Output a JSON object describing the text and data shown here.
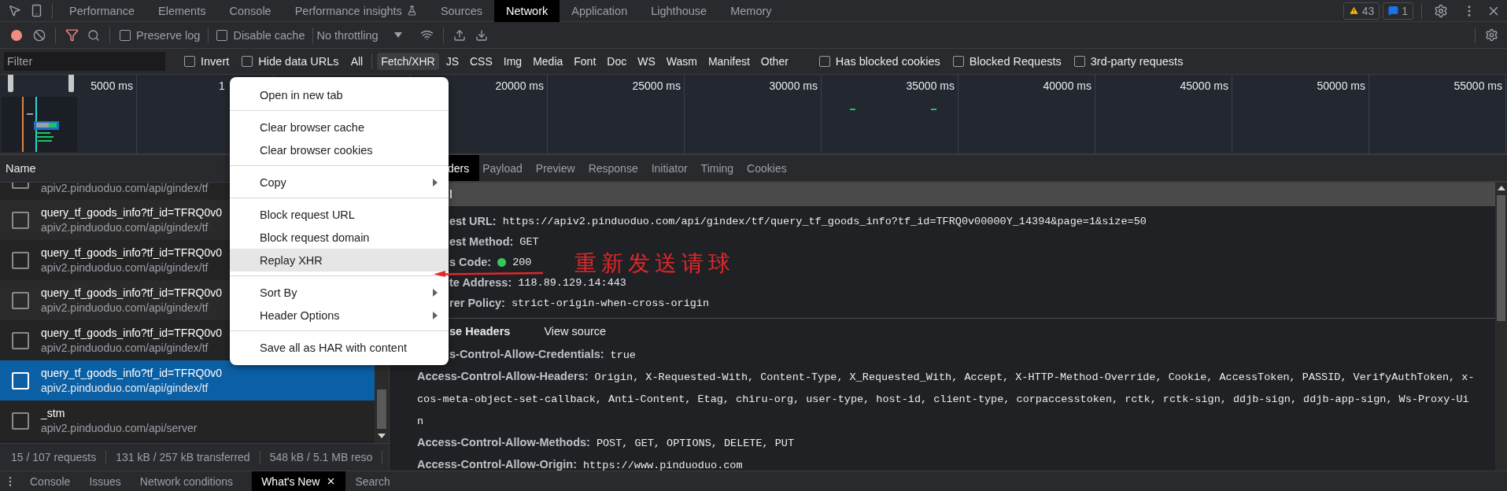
{
  "main_tabs": [
    {
      "label": "Performance",
      "selected": false,
      "experimental": false
    },
    {
      "label": "Elements",
      "selected": false,
      "experimental": false
    },
    {
      "label": "Console",
      "selected": false,
      "experimental": false
    },
    {
      "label": "Performance insights",
      "selected": false,
      "experimental": true
    },
    {
      "label": "Sources",
      "selected": false,
      "experimental": false
    },
    {
      "label": "Network",
      "selected": true,
      "experimental": false
    },
    {
      "label": "Application",
      "selected": false,
      "experimental": false
    },
    {
      "label": "Lighthouse",
      "selected": false,
      "experimental": false
    },
    {
      "label": "Memory",
      "selected": false,
      "experimental": false
    }
  ],
  "issue_counters": {
    "warnings": "43",
    "messages": "1"
  },
  "toolbar": {
    "recording": true,
    "filter_active": true,
    "checkboxes": [
      {
        "label": "Preserve log",
        "checked": false
      },
      {
        "label": "Disable cache",
        "checked": false
      }
    ],
    "throttling": "No throttling"
  },
  "filter_bar": {
    "placeholder": "Filter",
    "options_left": [
      {
        "label": "Invert",
        "checked": false
      },
      {
        "label": "Hide data URLs",
        "checked": false
      }
    ],
    "types": [
      {
        "label": "All",
        "selected": false
      },
      {
        "label": "Fetch/XHR",
        "selected": true
      },
      {
        "label": "JS",
        "selected": false
      },
      {
        "label": "CSS",
        "selected": false
      },
      {
        "label": "Img",
        "selected": false
      },
      {
        "label": "Media",
        "selected": false
      },
      {
        "label": "Font",
        "selected": false
      },
      {
        "label": "Doc",
        "selected": false
      },
      {
        "label": "WS",
        "selected": false
      },
      {
        "label": "Wasm",
        "selected": false
      },
      {
        "label": "Manifest",
        "selected": false
      },
      {
        "label": "Other",
        "selected": false
      }
    ],
    "options_right": [
      {
        "label": "Has blocked cookies",
        "checked": false
      },
      {
        "label": "Blocked Requests",
        "checked": false
      },
      {
        "label": "3rd-party requests",
        "checked": false
      }
    ]
  },
  "timeline": {
    "ticks_before_menu": [
      "5000 ms",
      "1"
    ],
    "ticks_after_menu": [
      "20000 ms",
      "25000 ms",
      "30000 ms",
      "35000 ms",
      "40000 ms",
      "45000 ms",
      "50000 ms",
      "55000 ms"
    ]
  },
  "requests": {
    "column": "Name",
    "rows": [
      {
        "url": "apiv2.pinduoduo.com/api/gindex/tf",
        "selected": false
      },
      {
        "name": "query_tf_goods_info?tf_id=TFRQ0v0",
        "url": "apiv2.pinduoduo.com/api/gindex/tf",
        "selected": false
      },
      {
        "name": "query_tf_goods_info?tf_id=TFRQ0v0",
        "url": "apiv2.pinduoduo.com/api/gindex/tf",
        "selected": false
      },
      {
        "name": "query_tf_goods_info?tf_id=TFRQ0v0",
        "url": "apiv2.pinduoduo.com/api/gindex/tf",
        "selected": false
      },
      {
        "name": "query_tf_goods_info?tf_id=TFRQ0v0",
        "url": "apiv2.pinduoduo.com/api/gindex/tf",
        "selected": false
      },
      {
        "name": "query_tf_goods_info?tf_id=TFRQ0v0",
        "url": "apiv2.pinduoduo.com/api/gindex/tf",
        "selected": true
      },
      {
        "name": "_stm",
        "url": "apiv2.pinduoduo.com/api/server",
        "selected": false
      }
    ]
  },
  "status_bar": [
    "15 / 107 requests",
    "131 kB / 257 kB transferred",
    "548 kB / 5.1 MB reso"
  ],
  "details": {
    "tabs": [
      {
        "label": "ders",
        "selected": true
      },
      {
        "label": "Payload",
        "selected": false
      },
      {
        "label": "Preview",
        "selected": false
      },
      {
        "label": "Response",
        "selected": false
      },
      {
        "label": "Initiator",
        "selected": false
      },
      {
        "label": "Timing",
        "selected": false
      },
      {
        "label": "Cookies",
        "selected": false
      }
    ],
    "general": {
      "title": "l",
      "rows": [
        {
          "label": "est URL:",
          "value": "https://apiv2.pinduoduo.com/api/gindex/tf/query_tf_goods_info?tf_id=TFRQ0v00000Y_14394&page=1&size=50"
        },
        {
          "label": "est Method:",
          "value": "GET"
        },
        {
          "label": "s Code:",
          "value": "200",
          "color": "#35c759"
        },
        {
          "label": "te Address:",
          "value": "118.89.129.14:443"
        },
        {
          "label": "rer Policy:",
          "value": "strict-origin-when-cross-origin"
        }
      ]
    },
    "response_headers": {
      "title": "se Headers",
      "view_source": "View source",
      "rows": [
        {
          "label": "s-Control-Allow-Credentials:",
          "value_lines": [
            "true"
          ]
        },
        {
          "label": "Access-Control-Allow-Headers:",
          "value_lines": [
            "Origin, X-Requested-With, Content-Type, X_Requested_With, Accept, X-HTTP-Method-Override, Cookie, AccessToken, PASSID, VerifyAuthToken, x-",
            "cos-meta-object-set-callback, Anti-Content, Etag, chiru-org, user-type, host-id, client-type, corpaccesstoken, rctk, rctk-sign, ddjb-sign, ddjb-app-sign, Ws-Proxy-Ui",
            "n"
          ]
        },
        {
          "label": "Access-Control-Allow-Methods:",
          "value_lines": [
            "POST, GET, OPTIONS, DELETE, PUT"
          ]
        },
        {
          "label": "Access-Control-Allow-Origin:",
          "value_lines": [
            "https://www.pinduoduo.com"
          ]
        }
      ]
    }
  },
  "context_menu": {
    "groups": [
      [
        {
          "label": "Open in new tab",
          "submenu": false,
          "highlighted": false
        }
      ],
      [
        {
          "label": "Clear browser cache",
          "submenu": false,
          "highlighted": false
        },
        {
          "label": "Clear browser cookies",
          "submenu": false,
          "highlighted": false
        }
      ],
      [
        {
          "label": "Copy",
          "submenu": true,
          "highlighted": false
        }
      ],
      [
        {
          "label": "Block request URL",
          "submenu": false,
          "highlighted": false
        },
        {
          "label": "Block request domain",
          "submenu": false,
          "highlighted": false
        },
        {
          "label": "Replay XHR",
          "submenu": false,
          "highlighted": true
        }
      ],
      [
        {
          "label": "Sort By",
          "submenu": true,
          "highlighted": false
        },
        {
          "label": "Header Options",
          "submenu": true,
          "highlighted": false
        }
      ],
      [
        {
          "label": "Save all as HAR with content",
          "submenu": false,
          "highlighted": false
        }
      ]
    ]
  },
  "annotation": {
    "text": "重新发送请球"
  },
  "drawer_tabs": [
    {
      "label": "Console",
      "selected": false,
      "closable": false
    },
    {
      "label": "Issues",
      "selected": false,
      "closable": false
    },
    {
      "label": "Network conditions",
      "selected": false,
      "closable": false
    },
    {
      "label": "What's New",
      "selected": true,
      "closable": true
    },
    {
      "label": "Search",
      "selected": false,
      "closable": false
    }
  ]
}
